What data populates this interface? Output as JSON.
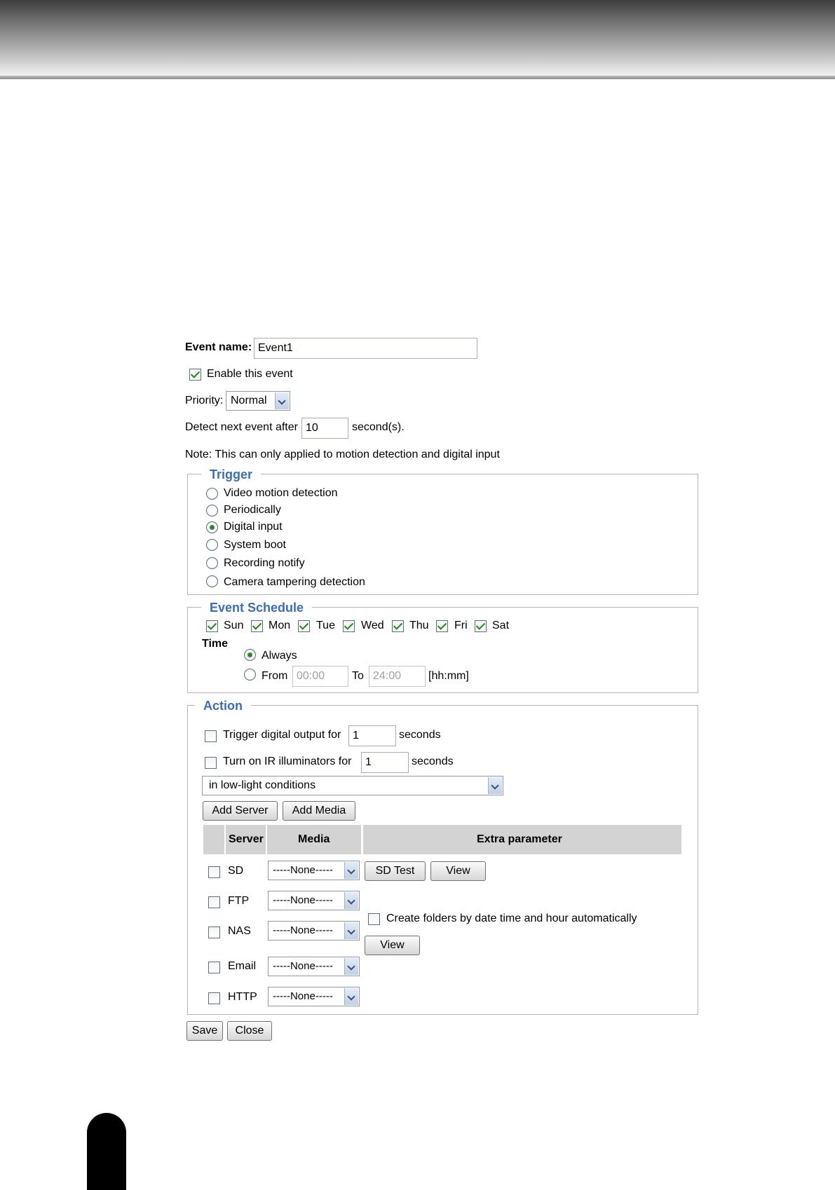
{
  "event": {
    "name_label": "Event name:",
    "name_value": "Event1",
    "enable_label": "Enable this event",
    "enable_checked": true,
    "priority_label": "Priority:",
    "priority_value": "Normal",
    "detect_label": "Detect next event after",
    "detect_value": "10",
    "detect_unit": "second(s).",
    "note": "Note: This can only applied to motion detection and digital input"
  },
  "trigger": {
    "legend": "Trigger",
    "options": [
      {
        "label": "Video motion detection",
        "checked": false
      },
      {
        "label": "Periodically",
        "checked": false
      },
      {
        "label": "Digital input",
        "checked": true
      },
      {
        "label": "System boot",
        "checked": false
      },
      {
        "label": "Recording notify",
        "checked": false
      },
      {
        "label": "Camera tampering detection",
        "checked": false
      }
    ]
  },
  "schedule": {
    "legend": "Event Schedule",
    "days": [
      {
        "label": "Sun",
        "checked": true
      },
      {
        "label": "Mon",
        "checked": true
      },
      {
        "label": "Tue",
        "checked": true
      },
      {
        "label": "Wed",
        "checked": true
      },
      {
        "label": "Thu",
        "checked": true
      },
      {
        "label": "Fri",
        "checked": true
      },
      {
        "label": "Sat",
        "checked": true
      }
    ],
    "time_label": "Time",
    "always_label": "Always",
    "from_label": "From",
    "from_value": "00:00",
    "to_label": "To",
    "to_value": "24:00",
    "format_hint": "[hh:mm]"
  },
  "action": {
    "legend": "Action",
    "digital_output_label": "Trigger digital output for",
    "digital_output_value": "1",
    "digital_output_unit": "seconds",
    "ir_label": "Turn on IR illuminators for",
    "ir_value": "1",
    "ir_unit": "seconds",
    "ir_condition": "in low-light conditions",
    "add_server_label": "Add Server",
    "add_media_label": "Add Media",
    "table_headers": {
      "server": "Server",
      "media": "Media",
      "extra": "Extra parameter"
    },
    "rows": [
      {
        "server": "SD",
        "media": "-----None-----"
      },
      {
        "server": "FTP",
        "media": "-----None-----"
      },
      {
        "server": "NAS",
        "media": "-----None-----"
      },
      {
        "server": "Email",
        "media": "-----None-----"
      },
      {
        "server": "HTTP",
        "media": "-----None-----"
      }
    ],
    "sd_test_label": "SD Test",
    "view_label": "View",
    "create_folders_label": "Create folders by date time and hour automatically"
  },
  "footer": {
    "save_label": "Save",
    "close_label": "Close"
  }
}
